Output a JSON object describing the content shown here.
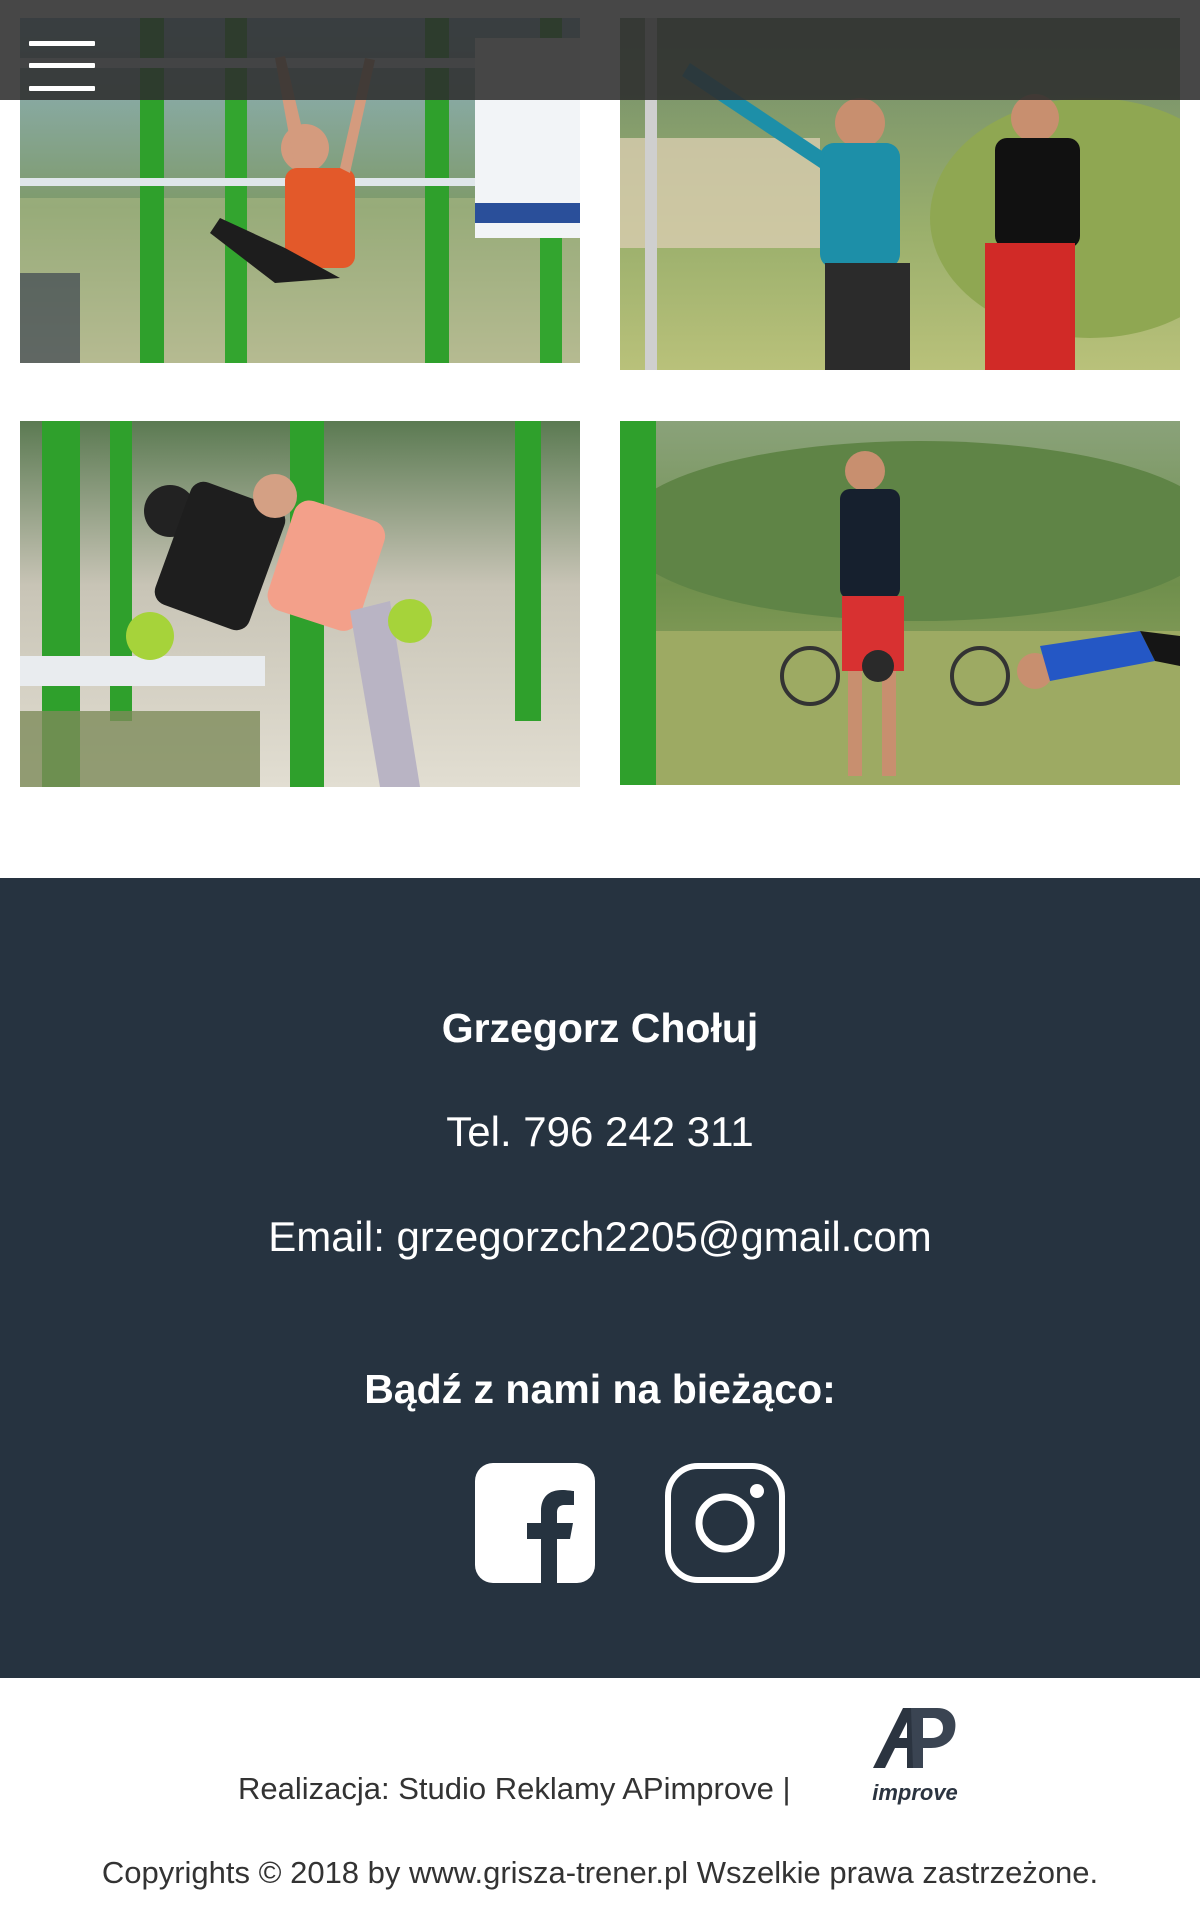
{
  "header": {
    "menu_icon": "hamburger-menu-icon"
  },
  "gallery": {
    "photos": [
      {
        "subject": "woman doing hanging leg raises on street-workout bars"
      },
      {
        "subject": "two men warming up outdoors"
      },
      {
        "subject": "two people doing kettlebell rows at bench"
      },
      {
        "subject": "man with kettlebell and man doing push-ups on grass"
      }
    ]
  },
  "contact": {
    "name": "Grzegorz Chołuj",
    "phone": "Tel. 796 242 311",
    "email": "Email: grzegorzch2205@gmail.com",
    "follow_heading": "Bądź z nami na bieżąco:",
    "social": [
      {
        "icon": "facebook-icon"
      },
      {
        "icon": "instagram-icon"
      }
    ]
  },
  "credits": {
    "realization": "Realizacja: Studio Reklamy APimprove |",
    "logo_text": "improve",
    "copyright": "Copyrights © 2018 by www.grisza-trener.pl Wszelkie prawa zastrzeżone."
  },
  "colors": {
    "footer_bg": "#263340",
    "topbar_bg": "#2d2d2d",
    "text_light": "#ffffff",
    "text_dark": "#333333"
  }
}
